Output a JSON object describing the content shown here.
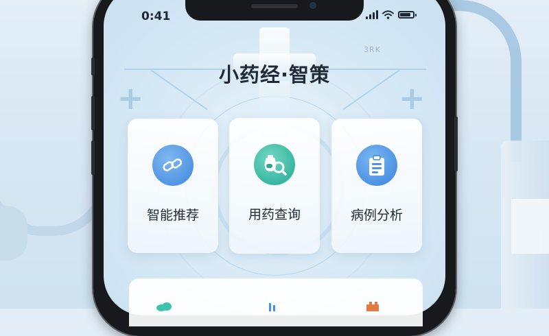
{
  "status_bar": {
    "time": "0:41",
    "signal_icon": "signal-icon",
    "wifi_icon": "wifi-icon",
    "battery_icon": "battery-icon"
  },
  "background_text": "3RK",
  "app": {
    "title": "小药经·智策"
  },
  "features": [
    {
      "label": "智能推荐",
      "icon": "link-chain-icon",
      "color": "#4a8fe0"
    },
    {
      "label": "用药查询",
      "icon": "medicine-search-icon",
      "color": "#2fb7a3"
    },
    {
      "label": "病例分析",
      "icon": "clipboard-icon",
      "color": "#3f8be0"
    }
  ],
  "bottom_panel": {
    "icons": [
      "leaf-icon",
      "chart-icon",
      "tower-icon"
    ]
  },
  "colors": {
    "accent_blue": "#4a8fe0",
    "accent_teal": "#2fb7a3",
    "title": "#1f2a36"
  }
}
